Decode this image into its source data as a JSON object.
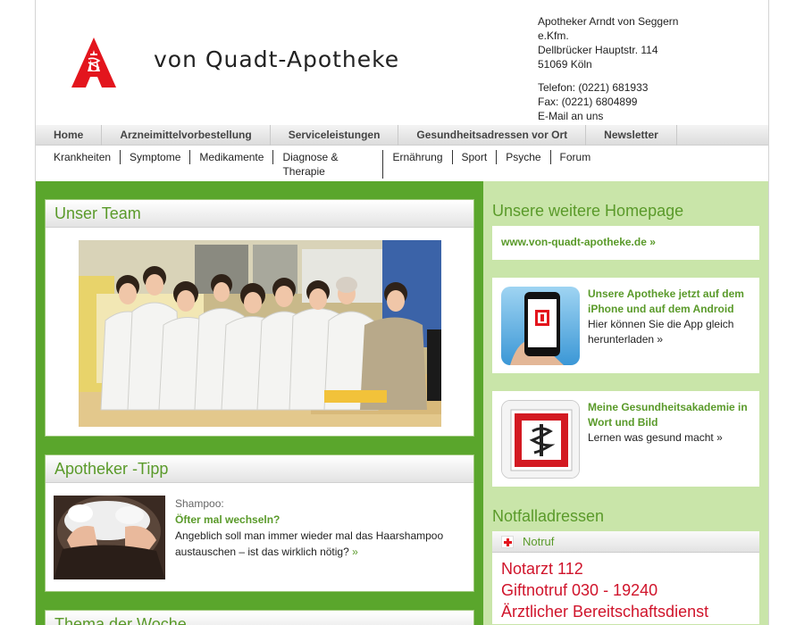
{
  "brand": "von Quadt-Apotheke",
  "address": {
    "lines": [
      "Apotheker Arndt von Seggern",
      "e.Kfm.",
      "Dellbrücker Hauptstr. 114",
      "51069 Köln"
    ],
    "contact": [
      "Telefon: (0221) 681933",
      "Fax: (0221) 6804899",
      "E-Mail an uns"
    ]
  },
  "main_nav": [
    "Home",
    "Arzneimittelvorbestellung",
    "Serviceleistungen",
    "Gesundheitsadressen vor Ort",
    "Newsletter"
  ],
  "sub_nav": [
    "Krankheiten",
    "Symptome",
    "Medikamente",
    "Diagnose & Therapie",
    "Ernährung",
    "Sport",
    "Psyche",
    "Forum"
  ],
  "team": {
    "title": "Unser Team"
  },
  "tip": {
    "title": "Apotheker -Tipp",
    "kicker": "Shampoo:",
    "headline": "Öfter mal wechseln?",
    "text": "Angeblich soll man immer wieder mal das Haarshampoo austauschen – ist das wirklich nötig?",
    "more": "»"
  },
  "week": {
    "title": "Thema der Woche"
  },
  "homepage": {
    "title": "Unsere weitere Homepage",
    "link": "www.von-quadt-apotheke.de",
    "more": "»"
  },
  "app": {
    "title": "Unsere Apotheke jetzt auf dem iPhone und auf dem Android",
    "text": "Hier können Sie die App gleich herunterladen",
    "more": "»"
  },
  "akademie": {
    "title": "Meine Gesundheitsakademie in Wort und Bild",
    "text": "Lernen was gesund macht",
    "more": "»"
  },
  "notfall": {
    "title": "Notfalladressen",
    "header": "Notruf",
    "lines": [
      "Notarzt 112",
      "Giftnotruf 030 - 19240",
      "Ärztlicher Bereitschaftsdienst"
    ]
  },
  "colors": {
    "green": "#5aa62c",
    "light_green": "#c9e5a9",
    "title_green": "#5a9a2a",
    "red": "#e3151d"
  }
}
